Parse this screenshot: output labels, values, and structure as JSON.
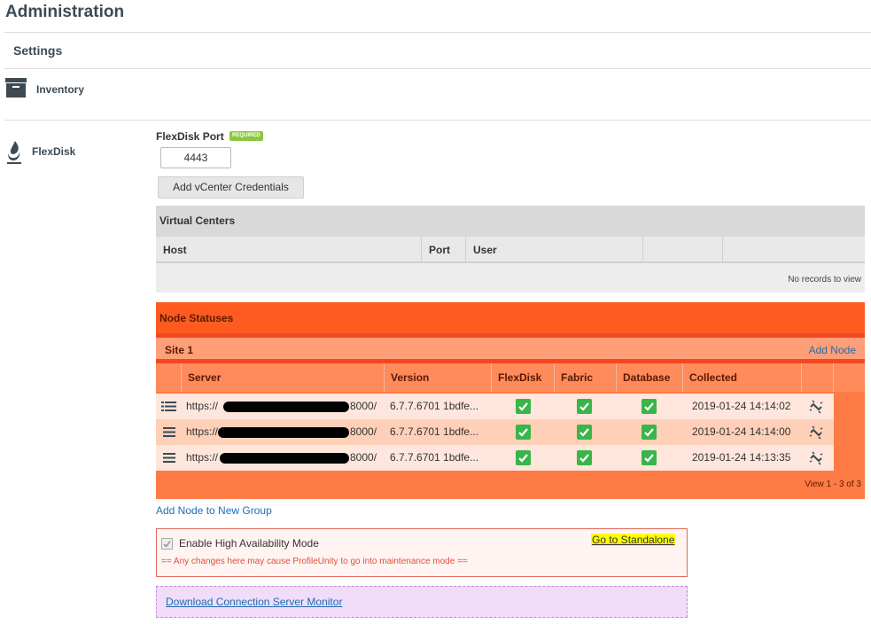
{
  "header": {
    "title": "Administration"
  },
  "nav": {
    "settings": "Settings",
    "inventory": "Inventory",
    "flexdisk": "FlexDisk"
  },
  "port": {
    "label": "FlexDisk Port",
    "required_badge": "REQUIRED",
    "value": "4443"
  },
  "vcenter": {
    "button": "Add vCenter Credentials",
    "title": "Virtual Centers",
    "columns": [
      "Host",
      "Port",
      "User",
      "",
      ""
    ],
    "empty": "No records to view"
  },
  "nodes": {
    "title": "Node Statuses",
    "site": "Site 1",
    "add_node": "Add Node",
    "columns": [
      "",
      "Server",
      "Version",
      "FlexDisk",
      "Fabric",
      "Database",
      "Collected",
      ""
    ],
    "rows": [
      {
        "server_prefix": "https://",
        "server_suffix": "8000/",
        "version": "6.7.7.6701 1bdfe...",
        "collected": "2019-01-24 14:14:02"
      },
      {
        "server_prefix": "https://",
        "server_suffix": "8000/",
        "version": "6.7.7.6701 1bdfe...",
        "collected": "2019-01-24 14:14:00"
      },
      {
        "server_prefix": "https://",
        "server_suffix": "8000/",
        "version": "6.7.7.6701 1bdfe...",
        "collected": "2019-01-24 14:13:35"
      }
    ],
    "footer": "View 1 - 3 of 3"
  },
  "add_group": "Add Node to New Group",
  "ha": {
    "label": "Enable High Availability Mode",
    "checked": true,
    "warning": "== Any changes here may cause ProfileUnity to go into maintenance mode ==",
    "standalone": "Go to Standalone"
  },
  "download": "Download Connection Server Monitor",
  "colors": {
    "accent": "#ff5a1f",
    "row_light": "#fee6dc",
    "row_dark": "#ffd0b8",
    "check_green": "#39b54a",
    "link_blue": "#1f6db3"
  }
}
